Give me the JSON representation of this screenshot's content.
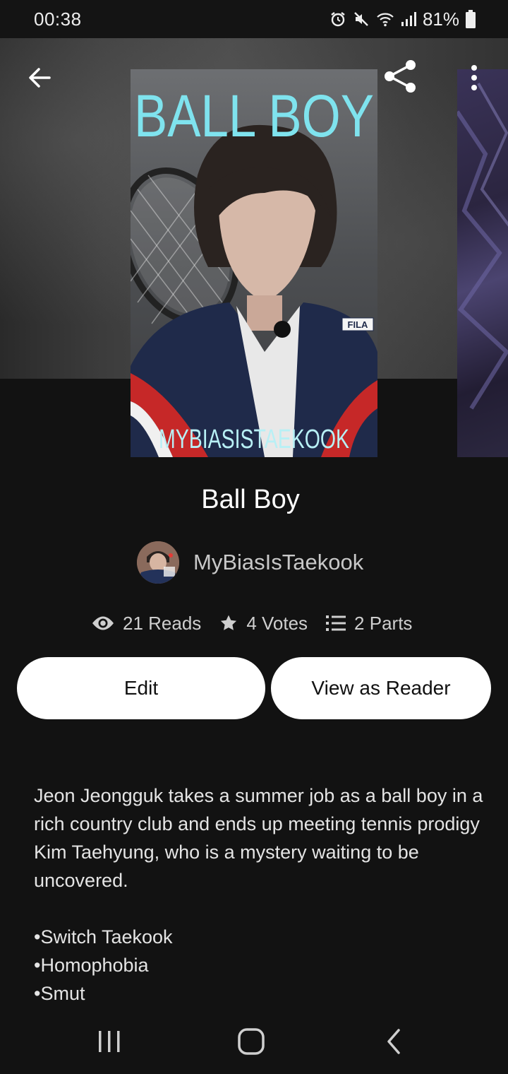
{
  "status_bar": {
    "time": "00:38",
    "battery_percent": "81%",
    "icons": [
      "alarm-icon",
      "mute-icon",
      "wifi-icon",
      "signal-icon",
      "battery-icon"
    ]
  },
  "header": {
    "back_icon": "arrow-left-icon",
    "share_icon": "share-icon",
    "more_icon": "more-vertical-icon"
  },
  "cover": {
    "title_text": "BALL BOY",
    "bottom_text": "MYBIASISTAEKOOK",
    "jacket_logo": "FILA"
  },
  "story": {
    "title": "Ball Boy",
    "author": "MyBiasIsTaekook"
  },
  "stats": {
    "reads": "21 Reads",
    "votes": "4 Votes",
    "parts": "2 Parts"
  },
  "buttons": {
    "edit": "Edit",
    "view_as_reader": "View as Reader"
  },
  "description": "Jeon Jeongguk takes a summer job as a ball boy in a rich country club and ends up meeting tennis prodigy Kim Taehyung, who is a mystery waiting to be uncovered.",
  "tags": [
    "•Switch Taekook",
    "•Homophobia",
    "•Smut"
  ],
  "colors": {
    "background": "#121212",
    "button": "#ffffff",
    "cover_title": "#7fe3ee"
  }
}
